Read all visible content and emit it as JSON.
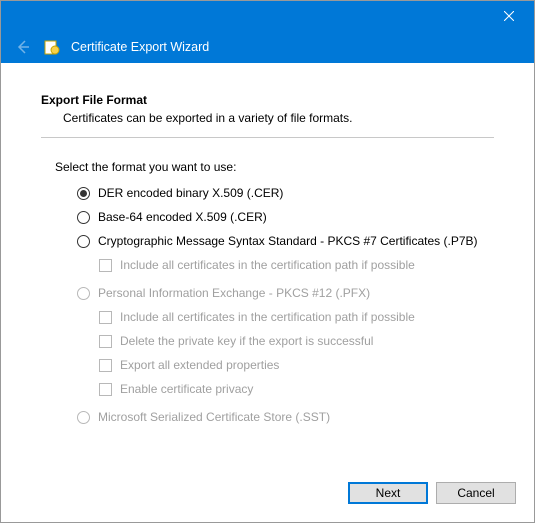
{
  "window": {
    "title": "Certificate Export Wizard"
  },
  "page": {
    "heading": "Export File Format",
    "subheading": "Certificates can be exported in a variety of file formats.",
    "prompt": "Select the format you want to use:"
  },
  "options": {
    "der": {
      "label": "DER encoded binary X.509 (.CER)",
      "selected": true,
      "enabled": true
    },
    "base64": {
      "label": "Base-64 encoded X.509 (.CER)",
      "selected": false,
      "enabled": true
    },
    "pkcs7": {
      "label": "Cryptographic Message Syntax Standard - PKCS #7 Certificates (.P7B)",
      "selected": false,
      "enabled": true,
      "include_chain": {
        "label": "Include all certificates in the certification path if possible",
        "checked": false,
        "enabled": false
      }
    },
    "pfx": {
      "label": "Personal Information Exchange - PKCS #12 (.PFX)",
      "selected": false,
      "enabled": false,
      "include_chain": {
        "label": "Include all certificates in the certification path if possible",
        "checked": false,
        "enabled": false
      },
      "delete_key": {
        "label": "Delete the private key if the export is successful",
        "checked": false,
        "enabled": false
      },
      "export_ext": {
        "label": "Export all extended properties",
        "checked": false,
        "enabled": false
      },
      "cert_privacy": {
        "label": "Enable certificate privacy",
        "checked": false,
        "enabled": false
      }
    },
    "sst": {
      "label": "Microsoft Serialized Certificate Store (.SST)",
      "selected": false,
      "enabled": false
    }
  },
  "buttons": {
    "next": "Next",
    "cancel": "Cancel"
  }
}
